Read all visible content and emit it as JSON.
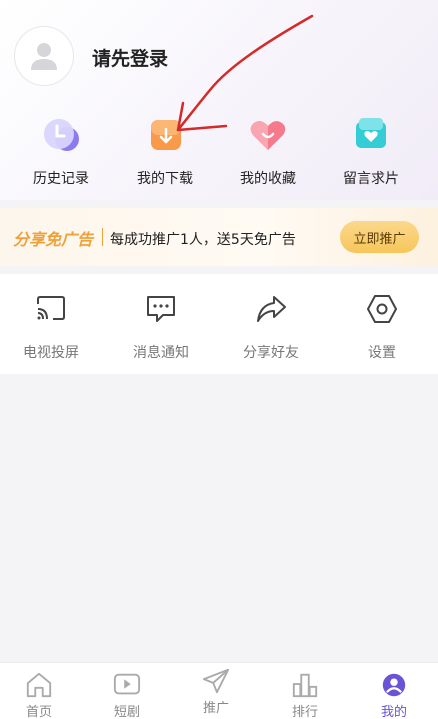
{
  "profile": {
    "login_prompt": "请先登录"
  },
  "quick_actions": [
    {
      "label": "历史记录",
      "icon": "history-icon"
    },
    {
      "label": "我的下载",
      "icon": "download-icon"
    },
    {
      "label": "我的收藏",
      "icon": "favorite-heart-icon"
    },
    {
      "label": "留言求片",
      "icon": "request-film-icon"
    }
  ],
  "promo": {
    "title": "分享免广告",
    "description": "每成功推广1人，送5天免广告",
    "button_label": "立即推广",
    "accent_color": "#f0a23a"
  },
  "tools": [
    {
      "label": "电视投屏",
      "icon": "cast-screen-icon"
    },
    {
      "label": "消息通知",
      "icon": "message-icon"
    },
    {
      "label": "分享好友",
      "icon": "share-icon"
    },
    {
      "label": "设置",
      "icon": "settings-icon"
    }
  ],
  "bottom_nav": {
    "active_index": 4,
    "active_color": "#6a53d6",
    "items": [
      {
        "label": "首页",
        "icon": "home-icon"
      },
      {
        "label": "短剧",
        "icon": "video-play-icon"
      },
      {
        "label": "推广",
        "icon": "paper-plane-icon"
      },
      {
        "label": "排行",
        "icon": "ranking-bars-icon"
      },
      {
        "label": "我的",
        "icon": "user-profile-icon"
      }
    ]
  }
}
